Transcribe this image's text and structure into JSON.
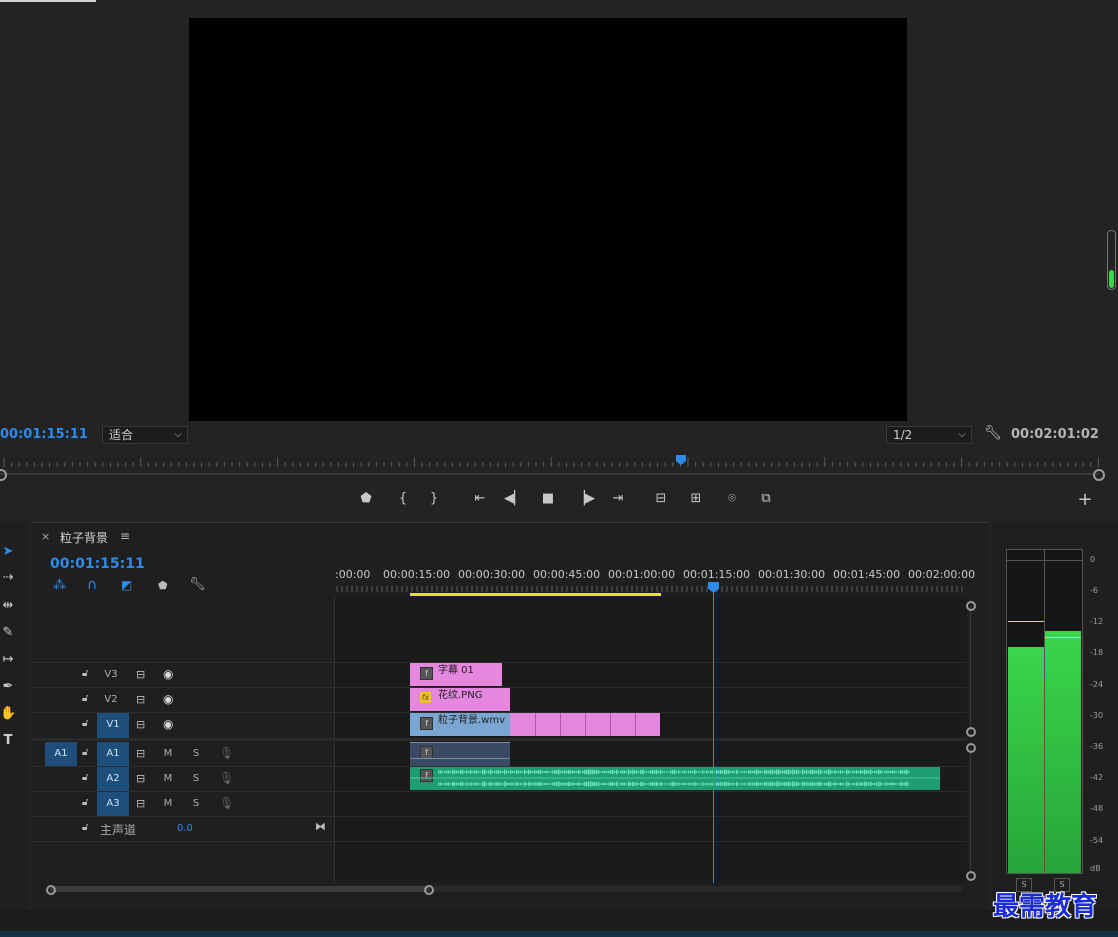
{
  "program_monitor": {
    "current_timecode": "00:01:15:11",
    "fit_dropdown": "适合",
    "resolution_dropdown": "1/2",
    "duration_timecode": "00:02:01:02"
  },
  "transport_buttons": [
    "marker",
    "mark-in",
    "mark-out",
    "go-to-in",
    "step-back",
    "stop",
    "step-forward",
    "go-to-out",
    "lift",
    "extract",
    "export-frame",
    "compare"
  ],
  "timeline": {
    "close_glyph": "×",
    "sequence_name": "粒子背景",
    "menu_glyph": "≡",
    "timecode": "00:01:15:11",
    "ruler_labels": [
      ":00:00",
      "00:00:15:00",
      "00:00:30:00",
      "00:00:45:00",
      "00:01:00:00",
      "00:01:15:00",
      "00:01:30:00",
      "00:01:45:00",
      "00:02:00:00"
    ],
    "video_tracks": [
      {
        "name": "V3",
        "target": false
      },
      {
        "name": "V2",
        "target": false
      },
      {
        "name": "V1",
        "target": true
      }
    ],
    "audio_tracks": [
      {
        "name": "A1",
        "source": "A1",
        "target": true
      },
      {
        "name": "A2",
        "target": true
      },
      {
        "name": "A3",
        "target": true
      }
    ],
    "audio_mute_label": "M",
    "audio_solo_label": "S",
    "master_track": {
      "label": "主声道",
      "value": "0.0"
    },
    "clips": {
      "v3_clip": "字幕 01",
      "v2_clip": "花纹.PNG",
      "v2_fx": "fx",
      "v1_clip": "粒子背景.wmv"
    }
  },
  "audio_meter": {
    "scale": [
      "0",
      "-6",
      "-12",
      "-18",
      "-24",
      "-30",
      "-36",
      "-42",
      "-48",
      "-54",
      "dB"
    ],
    "left_level": 0.7,
    "right_level": 0.75,
    "solo_labels": [
      "S",
      "S"
    ]
  },
  "watermark": "最需教育",
  "colors": {
    "accent": "#2d8ceb",
    "clip_pink": "#e586df",
    "audio_green": "#1d9e72",
    "meter_green": "#3ad64a",
    "work_area": "#e4e429"
  }
}
